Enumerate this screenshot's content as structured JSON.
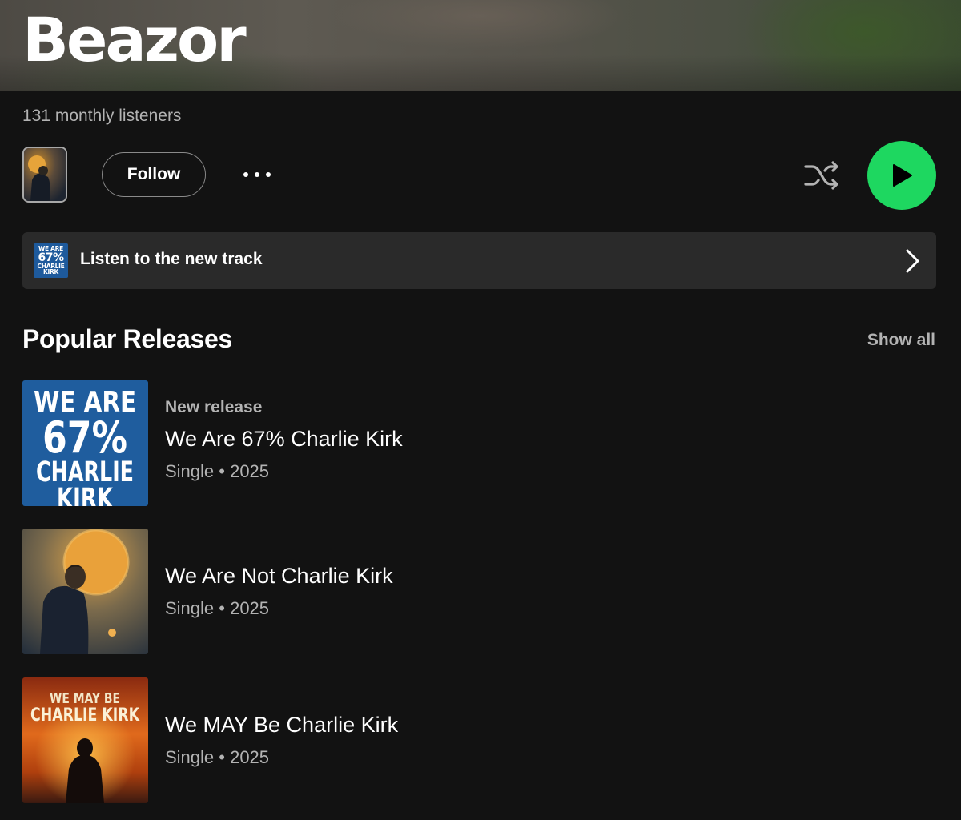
{
  "artist": {
    "name": "Beazor",
    "monthly_listeners": "131 monthly listeners"
  },
  "actions": {
    "follow_label": "Follow",
    "more_icon": "more-horizontal-icon",
    "shuffle_icon": "shuffle-icon",
    "play_icon": "play-icon",
    "accent_color": "#1ed760"
  },
  "promo": {
    "thumb_lines": [
      "WE ARE",
      "67%",
      "CHARLIE",
      "KIRK"
    ],
    "label": "Listen to the new track",
    "chevron_icon": "chevron-right-icon"
  },
  "popular_releases": {
    "title": "Popular Releases",
    "show_all_label": "Show all",
    "items": [
      {
        "badge": "New release",
        "title": "We Are 67% Charlie Kirk",
        "subtitle": "Single • 2025",
        "cover_lines": [
          "WE ARE",
          "67%",
          "CHARLIE",
          "KIRK"
        ]
      },
      {
        "badge": "",
        "title": "We Are Not Charlie Kirk",
        "subtitle": "Single • 2025",
        "cover_lines": []
      },
      {
        "badge": "",
        "title": "We MAY Be Charlie Kirk",
        "subtitle": "Single • 2025",
        "cover_lines": [
          "WE MAY BE",
          "CHARLIE KIRK"
        ]
      }
    ]
  }
}
